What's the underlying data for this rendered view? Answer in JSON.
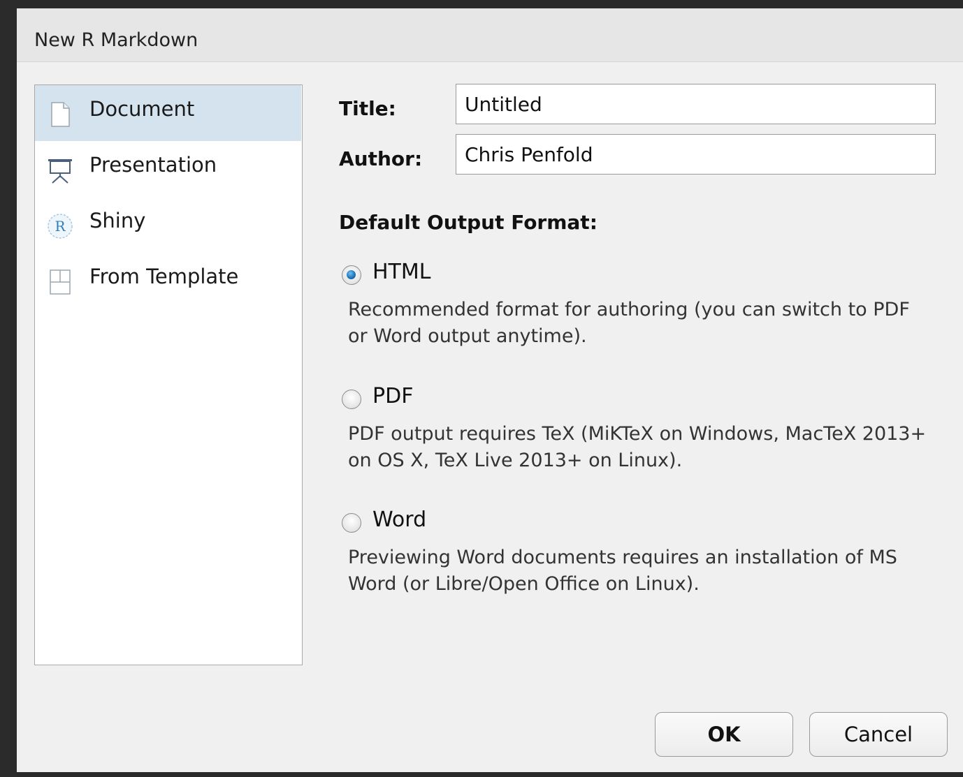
{
  "dialog": {
    "title": "New R Markdown"
  },
  "sidebar": {
    "items": [
      {
        "label": "Document",
        "icon": "document-icon",
        "selected": true
      },
      {
        "label": "Presentation",
        "icon": "presentation-icon",
        "selected": false
      },
      {
        "label": "Shiny",
        "icon": "shiny-r-icon",
        "selected": false
      },
      {
        "label": "From Template",
        "icon": "template-icon",
        "selected": false
      }
    ]
  },
  "form": {
    "title_label": "Title:",
    "title_value": "Untitled",
    "author_label": "Author:",
    "author_value": "Chris Penfold"
  },
  "output_format": {
    "heading": "Default Output Format:",
    "options": [
      {
        "label": "HTML",
        "checked": true,
        "description": "Recommended format for authoring (you can switch to PDF or Word output anytime)."
      },
      {
        "label": "PDF",
        "checked": false,
        "description": "PDF output requires TeX (MiKTeX on Windows, MacTeX 2013+ on OS X, TeX Live 2013+ on Linux)."
      },
      {
        "label": "Word",
        "checked": false,
        "description": "Previewing Word documents requires an installation of MS Word (or Libre/Open Office on Linux)."
      }
    ]
  },
  "buttons": {
    "ok_label": "OK",
    "cancel_label": "Cancel"
  },
  "colors": {
    "selected_bg": "#d5e3ef",
    "radio_accent": "#1a6fb5"
  }
}
